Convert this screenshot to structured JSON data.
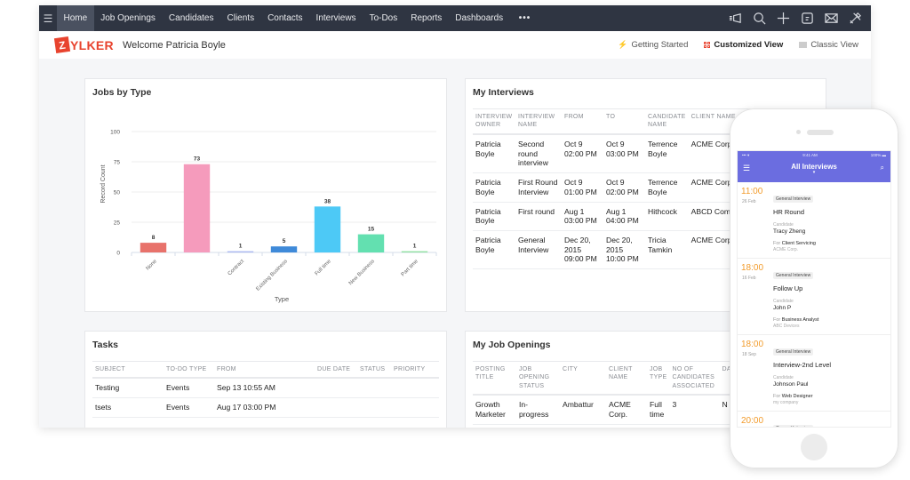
{
  "nav": {
    "items": [
      {
        "label": "Home",
        "active": true
      },
      {
        "label": "Job Openings",
        "active": false
      },
      {
        "label": "Candidates",
        "active": false
      },
      {
        "label": "Clients",
        "active": false
      },
      {
        "label": "Contacts",
        "active": false
      },
      {
        "label": "Interviews",
        "active": false
      },
      {
        "label": "To-Dos",
        "active": false
      },
      {
        "label": "Reports",
        "active": false
      },
      {
        "label": "Dashboards",
        "active": false
      }
    ],
    "more_label": "•••",
    "right_icons": [
      "announcement-icon",
      "search-icon",
      "add-icon",
      "calendar-icon",
      "mail-icon",
      "settings-tools-icon"
    ]
  },
  "subheader": {
    "logo_initial": "Z",
    "logo_rest": "YLKER",
    "welcome": "Welcome Patricia Boyle",
    "getting_started": "Getting Started",
    "customized_view": "Customized View",
    "classic_view": "Classic View"
  },
  "jobs_by_type": {
    "title": "Jobs by Type"
  },
  "chart_data": {
    "type": "bar",
    "title": "Jobs by Type",
    "xlabel": "Type",
    "ylabel": "Record Count",
    "ylim": [
      0,
      100
    ],
    "yticks": [
      0,
      25,
      50,
      75,
      100
    ],
    "grid": true,
    "legend": "none",
    "categories": [
      "None",
      "",
      "Contract",
      "Existing Business",
      "Full time",
      "New Business",
      "Part time"
    ],
    "values": [
      8,
      73,
      1,
      5,
      38,
      15,
      1
    ],
    "colors": [
      "#e8726b",
      "#f59bbc",
      "#a9b8f0",
      "#3f8ad9",
      "#4dc9f6",
      "#63e0b0",
      "#8fe0a0"
    ]
  },
  "interviews": {
    "title": "My Interviews",
    "columns": [
      "INTERVIEW OWNER",
      "INTERVIEW NAME",
      "FROM",
      "TO",
      "CANDIDATE NAME",
      "CLIENT NAME"
    ],
    "rows": [
      {
        "owner": "Patricia Boyle",
        "name": "Second round interview",
        "from": "Oct 9 02:00 PM",
        "to": "Oct 9 03:00 PM",
        "candidate": "Terrence Boyle",
        "client": "ACME Corp."
      },
      {
        "owner": "Patricia Boyle",
        "name": "First Round Interview",
        "from": "Oct 9 01:00 PM",
        "to": "Oct 9 02:00 PM",
        "candidate": "Terrence Boyle",
        "client": "ACME Corp."
      },
      {
        "owner": "Patricia Boyle",
        "name": "First round",
        "from": "Aug 1 03:00 PM",
        "to": "Aug 1 04:00 PM",
        "candidate": "Hithcock",
        "client": "ABCD Company"
      },
      {
        "owner": "Patricia Boyle",
        "name": "General Interview",
        "from": "Dec 20, 2015 09:00 PM",
        "to": "Dec 20, 2015 10:00 PM",
        "candidate": "Tricia Tamkin",
        "client": "ACME Corp."
      }
    ]
  },
  "tasks": {
    "title": "Tasks",
    "columns": [
      "SUBJECT",
      "TO-DO TYPE",
      "FROM",
      "DUE DATE",
      "STATUS",
      "PRIORITY"
    ],
    "rows": [
      {
        "subject": "Testing",
        "type": "Events",
        "from": "Sep 13 10:55 AM",
        "due": "",
        "status": "",
        "priority": ""
      },
      {
        "subject": "tsets",
        "type": "Events",
        "from": "Aug 17 03:00 PM",
        "due": "",
        "status": "",
        "priority": ""
      }
    ]
  },
  "job_openings": {
    "title": "My Job Openings",
    "columns": [
      "POSTING TITLE",
      "JOB OPENING STATUS",
      "CITY",
      "CLIENT NAME",
      "JOB TYPE",
      "NO OF CANDIDATES ASSOCIATED",
      "DA OI"
    ],
    "rows": [
      {
        "title": "Growth Marketer",
        "status": "In-progress",
        "city": "Ambattur",
        "client": "ACME Corp.",
        "type": "Full time",
        "candidates": "3",
        "extra": "N"
      }
    ]
  },
  "phone": {
    "status_left": "••• ▾",
    "status_time": "9:41 AM",
    "status_right": "100% ▬",
    "title": "All Interviews",
    "items": [
      {
        "time": "11:00",
        "date": "26 Feb",
        "badge": "General Interview",
        "name": "HR Round",
        "candidate_label": "Candidate",
        "candidate": "Tracy Zheng",
        "for_label": "For",
        "position": "Client Servicing",
        "org": "ACME Corp."
      },
      {
        "time": "18:00",
        "date": "16 Feb",
        "badge": "General Interview",
        "name": "Follow Up",
        "candidate_label": "Candidate",
        "candidate": "John P",
        "for_label": "For",
        "position": "Business Analyst",
        "org": "ABC Devices"
      },
      {
        "time": "18:00",
        "date": "18 Sep",
        "badge": "General Interview",
        "name": "Interview-2nd Level",
        "candidate_label": "Candidate",
        "candidate": "Johnson Paul",
        "for_label": "For",
        "position": "Web Designer",
        "org": "my company"
      },
      {
        "time": "20:00",
        "date": "",
        "badge": "General Interview",
        "name": "",
        "candidate_label": "",
        "candidate": "",
        "for_label": "",
        "position": "",
        "org": ""
      }
    ]
  }
}
